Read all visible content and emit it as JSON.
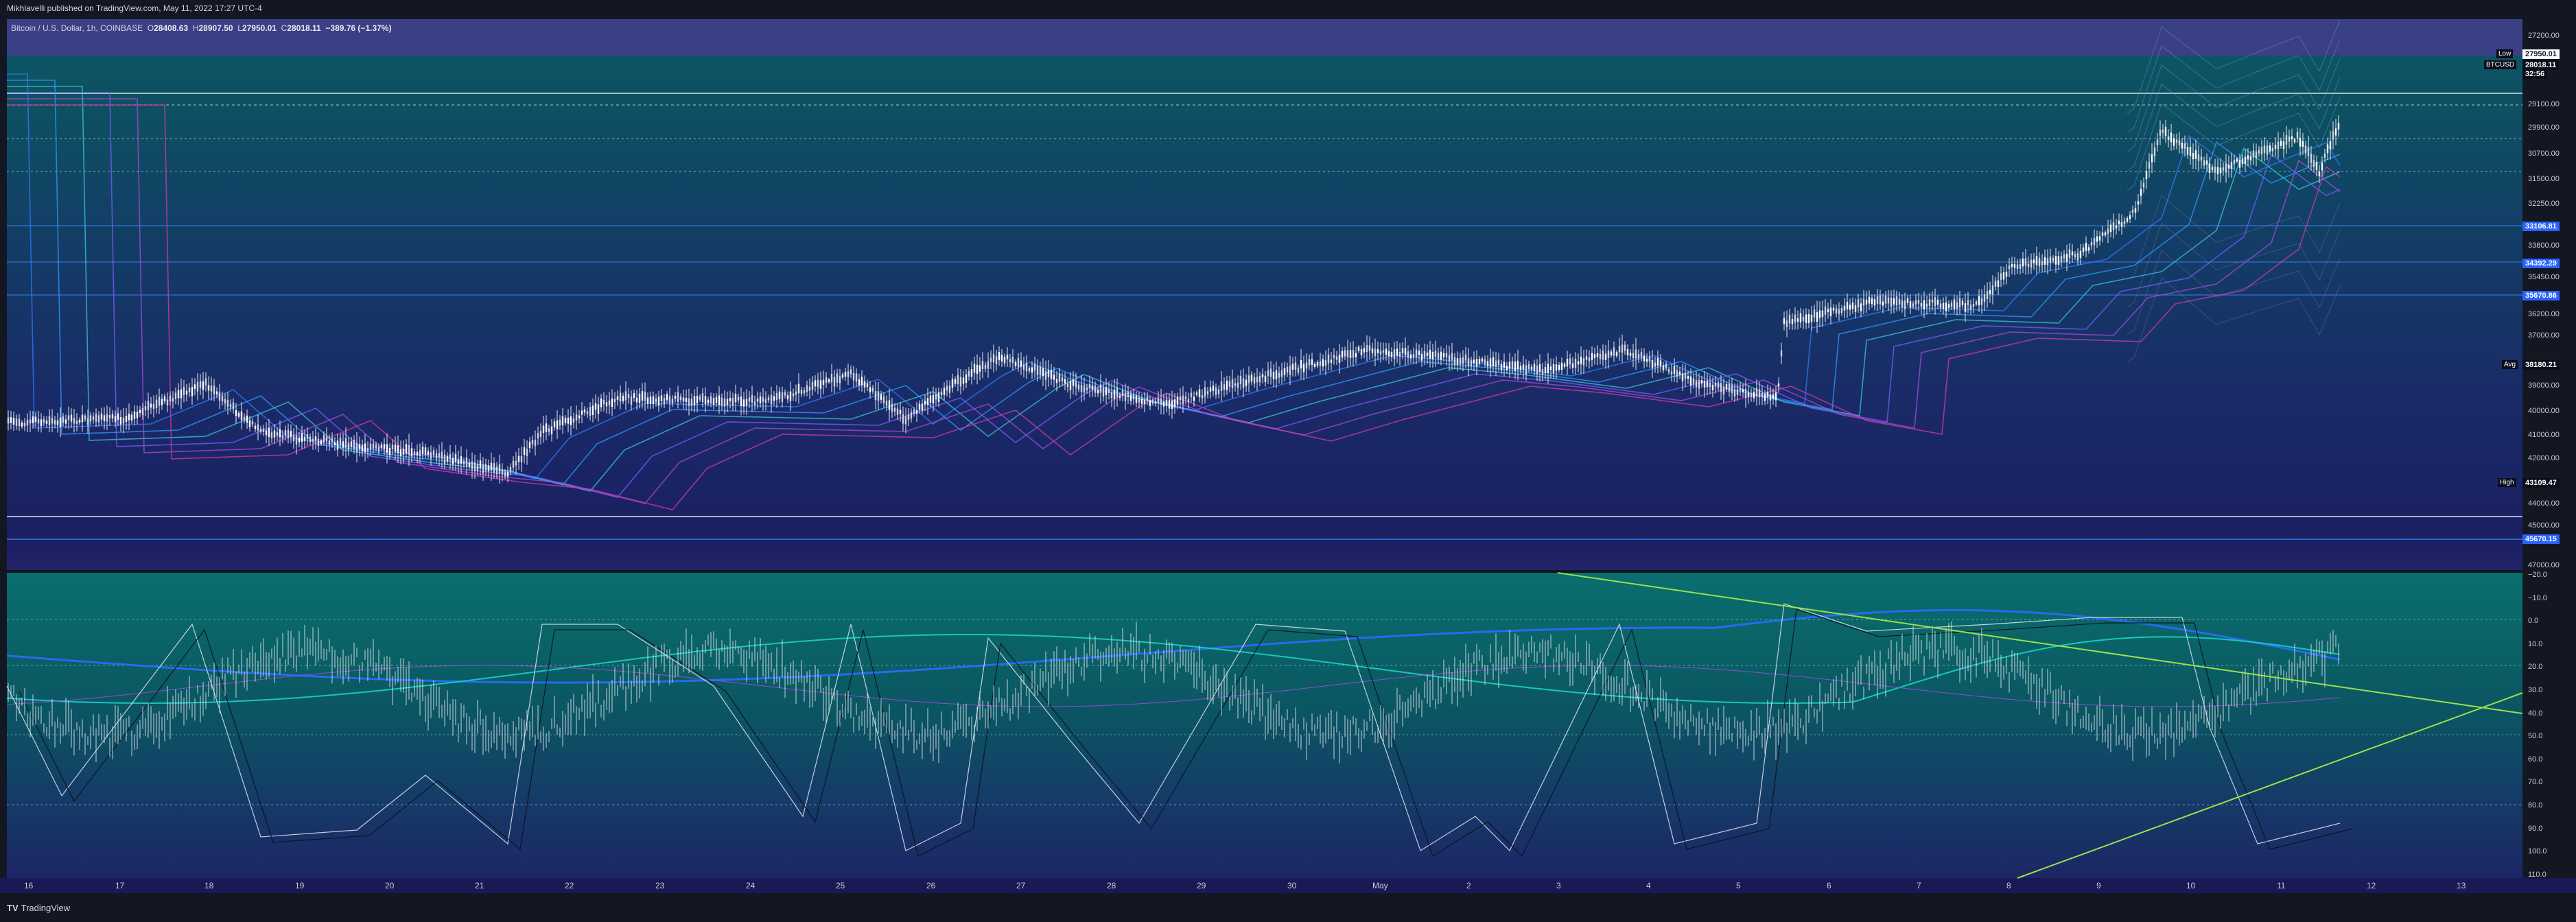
{
  "header": {
    "published": "Mikhlavelli published on TradingView.com, May 11, 2022 17:27 UTC-4"
  },
  "symbol": {
    "name": "Bitcoin / U.S. Dollar, 1h, COINBASE",
    "open_label": "O",
    "open": "28408.63",
    "high_label": "H",
    "high": "28907.50",
    "low_label": "L",
    "low": "27950.01",
    "close_label": "C",
    "close": "28018.11",
    "change": "−389.76 (−1.37%)"
  },
  "price_scale": [
    "27200.00",
    "29100.00",
    "29900.00",
    "30700.00",
    "31500.00",
    "32250.00",
    "33800.00",
    "35450.00",
    "36200.00",
    "37000.00",
    "39000.00",
    "40000.00",
    "41000.00",
    "42000.00",
    "44000.00",
    "45000.00",
    "47000.00"
  ],
  "price_tags": {
    "low_label": "Low",
    "low_value": "27950.01",
    "ticker": "BTCUSD",
    "last_price": "28018.11",
    "countdown": "32:56",
    "level1": "33106.81",
    "level2": "34392.29",
    "level3": "35670.86",
    "avg_label": "Avg",
    "avg_value": "38180.21",
    "high_label": "High",
    "high_value": "43109.47",
    "level4": "45670.15"
  },
  "osc_scale": [
    "−20.0",
    "−10.0",
    "0.0",
    "10.0",
    "20.0",
    "30.0",
    "40.0",
    "50.0",
    "60.0",
    "70.0",
    "80.0",
    "90.0",
    "100.0",
    "110.0"
  ],
  "time_axis": [
    "16",
    "17",
    "18",
    "19",
    "20",
    "21",
    "22",
    "23",
    "24",
    "25",
    "26",
    "27",
    "28",
    "29",
    "30",
    "May",
    "2",
    "3",
    "4",
    "5",
    "6",
    "7",
    "8",
    "9",
    "10",
    "11",
    "12",
    "13"
  ],
  "footer": {
    "logo_icon": "tradingview-logo-icon",
    "brand": "TradingView"
  },
  "colors": {
    "ribbon_fast": "#2f7bff",
    "ribbon_slow": "#d63aa8",
    "candles": "#e8eaf0",
    "trendline": "#9be04a",
    "osc_slow_ma": "#2a6cff",
    "osc_fast_ma": "#18d1c8"
  }
}
